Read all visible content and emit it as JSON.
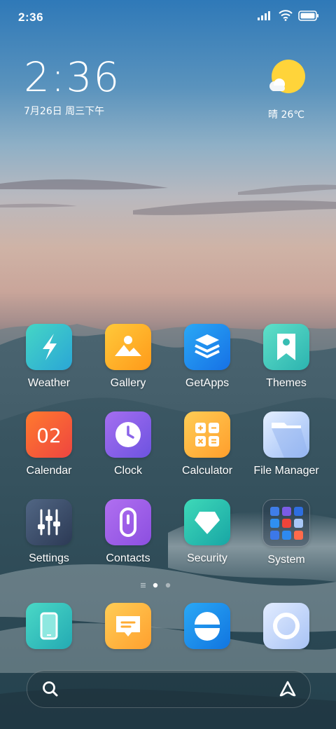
{
  "status_bar": {
    "time": "2:36",
    "icons": [
      "signal-icon",
      "wifi-icon",
      "battery-icon"
    ]
  },
  "clock_widget": {
    "time": "2:36",
    "date": "7月26日 周三下午"
  },
  "weather_widget": {
    "text": "晴 26℃",
    "icon": "sunny-partly-cloudy-icon"
  },
  "apps": [
    {
      "label": "Weather",
      "icon": "lightning-icon"
    },
    {
      "label": "Gallery",
      "icon": "landscape-icon"
    },
    {
      "label": "GetApps",
      "icon": "layers-icon"
    },
    {
      "label": "Themes",
      "icon": "bookmark-icon"
    },
    {
      "label": "Calendar",
      "icon": "calendar-icon",
      "icon_text": "02"
    },
    {
      "label": "Clock",
      "icon": "clock-icon"
    },
    {
      "label": "Calculator",
      "icon": "calculator-icon"
    },
    {
      "label": "File Manager",
      "icon": "folder-icon"
    },
    {
      "label": "Settings",
      "icon": "sliders-icon"
    },
    {
      "label": "Contacts",
      "icon": "contacts-icon"
    },
    {
      "label": "Security",
      "icon": "shield-icon"
    },
    {
      "label": "System",
      "icon": "folder-grid-icon"
    }
  ],
  "dock": [
    {
      "icon": "phone-icon"
    },
    {
      "icon": "message-icon"
    },
    {
      "icon": "browser-icon"
    },
    {
      "icon": "camera-icon"
    }
  ],
  "page_indicator": {
    "pages": 2,
    "current": 1
  },
  "search_bar": {
    "left_icon": "search-icon",
    "right_icon": "assistant-icon"
  },
  "colors": {
    "weather": "#3cc3c7",
    "gallery": "#ffb21a",
    "getapps": "#1e8cf0",
    "themes": "#3cc9b9",
    "calendar": "#f35d3c",
    "clock": "#8b65e8",
    "calculator": "#ffb23a",
    "filemanager": "#b9d4fb",
    "settings": "#3d4d68",
    "contacts": "#a45de0",
    "security": "#29c9b0",
    "phone": "#30c5b6",
    "message": "#ffb53b",
    "browser": "#1993f0",
    "camera": "#bcd0f7"
  }
}
